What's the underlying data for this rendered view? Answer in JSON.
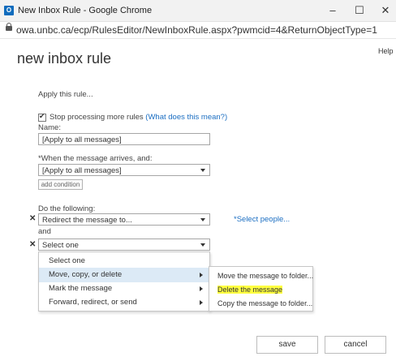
{
  "window": {
    "app_icon": "outlook-icon",
    "app_icon_text": "O",
    "title": "New Inbox Rule - Google Chrome",
    "minimize": "–",
    "maximize": "☐",
    "close": "✕"
  },
  "address_bar": {
    "icon": "lock-icon",
    "url": "owa.unbc.ca/ecp/RulesEditor/NewInboxRule.aspx?pwmcid=4&ReturnObjectType=1"
  },
  "page": {
    "title": "new inbox rule",
    "help": "Help"
  },
  "form": {
    "apply_label": "Apply this rule...",
    "stop_processing_label": "Stop processing more rules",
    "stop_processing_link": "(What does this mean?)",
    "stop_processing_checked": true,
    "name_label": "Name:",
    "name_value": "[Apply to all messages]",
    "when_label": "*When the message arrives, and:",
    "when_value": "[Apply to all messages]",
    "add_condition": "add condition",
    "do_following_label": "Do the following:",
    "action_value": "Redirect the message to...",
    "select_people": "*Select people...",
    "and_label": "and",
    "second_action_value": "Select one"
  },
  "dropdown": {
    "items": [
      {
        "label": "Select one"
      },
      {
        "label": "Move, copy, or delete",
        "active": true
      },
      {
        "label": "Mark the message"
      },
      {
        "label": "Forward, redirect, or send"
      }
    ]
  },
  "submenu": {
    "items": [
      {
        "label": "Move the message to folder..."
      },
      {
        "label": "Delete the message",
        "highlighted": true
      },
      {
        "label": "Copy the message to folder..."
      }
    ]
  },
  "footer": {
    "save": "save",
    "cancel": "cancel"
  },
  "colors": {
    "link": "#1b6ec2",
    "highlight": "#ffff40",
    "active_item": "#dceaf6"
  }
}
